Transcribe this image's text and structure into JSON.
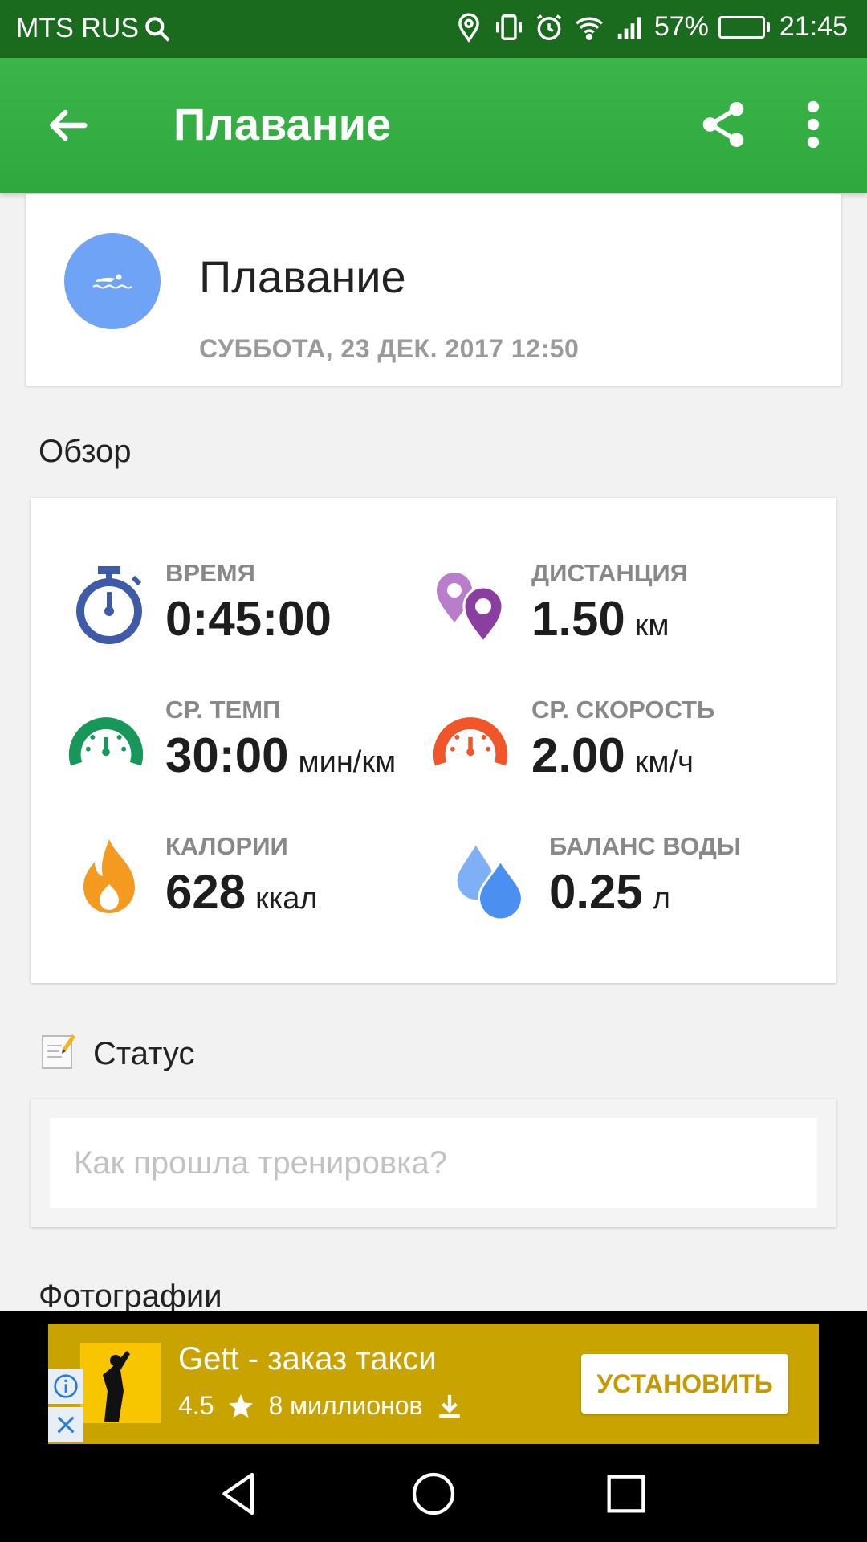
{
  "status_bar": {
    "carrier": "MTS RUS",
    "battery_percent": "57%",
    "battery_level": 0.57,
    "time": "21:45",
    "icons": [
      "search-icon",
      "location-icon",
      "vibrate-icon",
      "alarm-icon",
      "wifi-icon",
      "signal-icon",
      "battery-charging-icon"
    ]
  },
  "app_bar": {
    "title": "Плавание",
    "icons": [
      "back-arrow-icon",
      "share-icon",
      "more-vert-icon"
    ]
  },
  "header": {
    "activity_name": "Плавание",
    "date": "СУББОТА, 23 ДЕК. 2017 12:50",
    "icon": "swimmer-icon",
    "avatar_color": "#6fa3f5"
  },
  "overview": {
    "title": "Обзор",
    "metrics": [
      {
        "label": "ВРЕМЯ",
        "value": "0:45:00",
        "unit": "",
        "icon": "stopwatch-icon",
        "color": "#3f5aa8"
      },
      {
        "label": "ДИСТАНЦИЯ",
        "value": "1.50",
        "unit": "км",
        "icon": "map-pin-icon",
        "color": "#8a3fa0"
      },
      {
        "label": "СР. ТЕМП",
        "value": "30:00",
        "unit": "мин/км",
        "icon": "pace-gauge-icon",
        "color": "#18975a"
      },
      {
        "label": "СР. СКОРОСТЬ",
        "value": "2.00",
        "unit": "км/ч",
        "icon": "speed-gauge-icon",
        "color": "#f0562a"
      },
      {
        "label": "КАЛОРИИ",
        "value": "628",
        "unit": "ккал",
        "icon": "flame-icon",
        "color": "#f39a1f"
      },
      {
        "label": "БАЛАНС ВОДЫ",
        "value": "0.25",
        "unit": "л",
        "icon": "water-drops-icon",
        "color": "#4b8ff0"
      }
    ]
  },
  "status": {
    "title": "Статус",
    "icon": "note-pencil-icon",
    "placeholder": "Как прошла тренировка?"
  },
  "photos": {
    "title": "Фотографии"
  },
  "ad": {
    "title": "Gett - заказ такси",
    "rating": "4.5",
    "downloads": "8 миллионов",
    "install_label": "УСТАНОВИТЬ",
    "icons": [
      "info-icon",
      "close-icon",
      "star-icon",
      "download-icon"
    ]
  },
  "nav_bar": {
    "icons": [
      "nav-back-icon",
      "nav-home-icon",
      "nav-recents-icon"
    ]
  }
}
